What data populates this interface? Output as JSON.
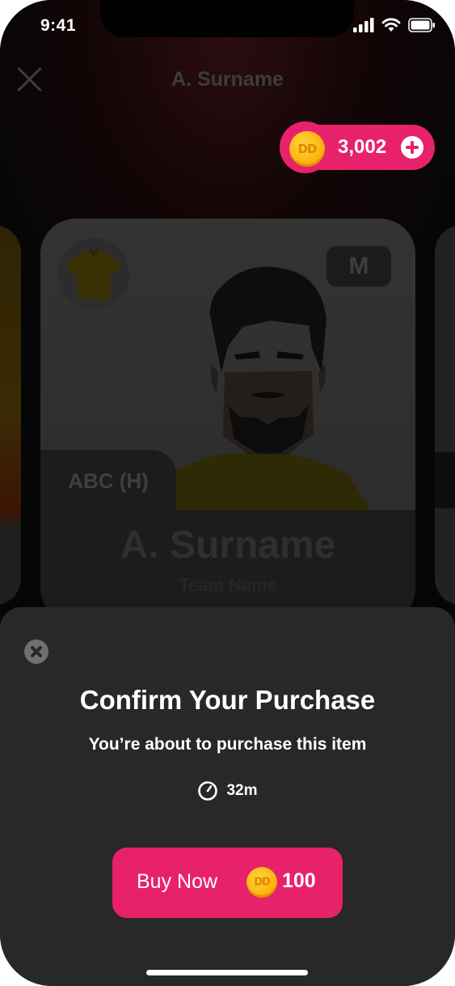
{
  "status_bar": {
    "time": "9:41"
  },
  "header": {
    "title": "A. Surname"
  },
  "wallet": {
    "coin_symbol": "DD",
    "balance": "3,002"
  },
  "player_card": {
    "position_badge": "M",
    "fixture_tag": "ABC (H)",
    "player_name": "A. Surname",
    "team_name": "Team Name"
  },
  "purchase_sheet": {
    "title": "Confirm Your Purchase",
    "subtitle": "You’re about to purchase this item",
    "timer": "32m",
    "buy_label": "Buy Now",
    "coin_symbol": "DD",
    "price": "100"
  },
  "colors": {
    "accent": "#e8226a",
    "sheet_bg": "#282828",
    "coin": "#fdb813"
  }
}
